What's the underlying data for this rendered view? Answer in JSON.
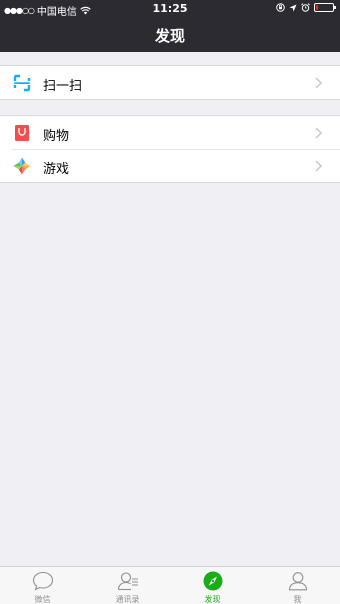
{
  "status_bar": {
    "signal_dots": "●●●○○",
    "carrier": "中国电信",
    "time": "11:25",
    "battery_level": 0.15,
    "battery_color": "#e0302a"
  },
  "nav": {
    "title": "发现"
  },
  "menu": {
    "group1": [
      {
        "label": "扫一扫",
        "icon": "scan-icon"
      }
    ],
    "group2": [
      {
        "label": "购物",
        "icon": "shopping-bag-icon"
      },
      {
        "label": "游戏",
        "icon": "game-icon"
      }
    ]
  },
  "tabbar": {
    "items": [
      {
        "label": "微信",
        "icon": "chat-bubble-icon",
        "active": false
      },
      {
        "label": "通讯录",
        "icon": "contacts-icon",
        "active": false
      },
      {
        "label": "发现",
        "icon": "compass-icon",
        "active": true
      },
      {
        "label": "我",
        "icon": "person-icon",
        "active": false
      }
    ],
    "active_color": "#1aad19",
    "inactive_color": "#8f8f8f"
  }
}
